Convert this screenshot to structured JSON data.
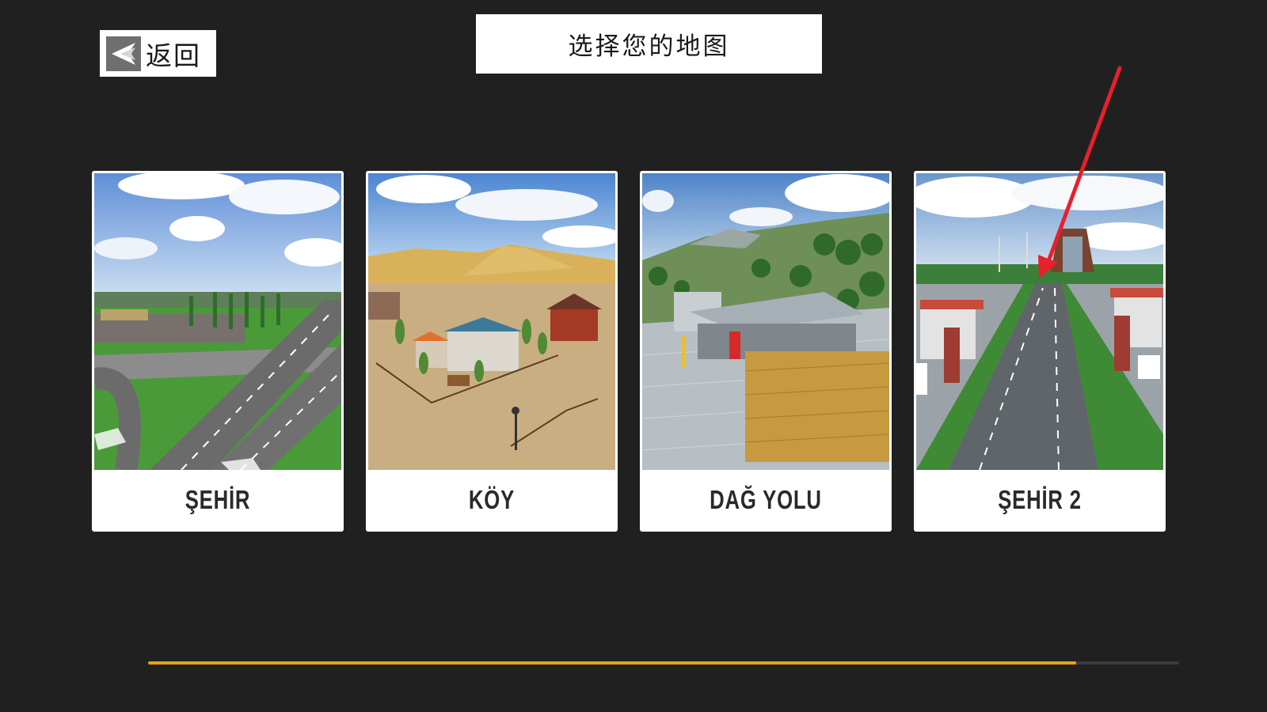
{
  "header": {
    "back_label": "返回",
    "title": "选择您的地图"
  },
  "maps": [
    {
      "label": "ŞEHİR"
    },
    {
      "label": "KÖY"
    },
    {
      "label": "DAĞ YOLU"
    },
    {
      "label": "ŞEHİR 2"
    }
  ],
  "progress": {
    "value": 0.9
  },
  "colors": {
    "background": "#202020",
    "progress": "#e8a31a",
    "arrow": "#e8202a"
  }
}
